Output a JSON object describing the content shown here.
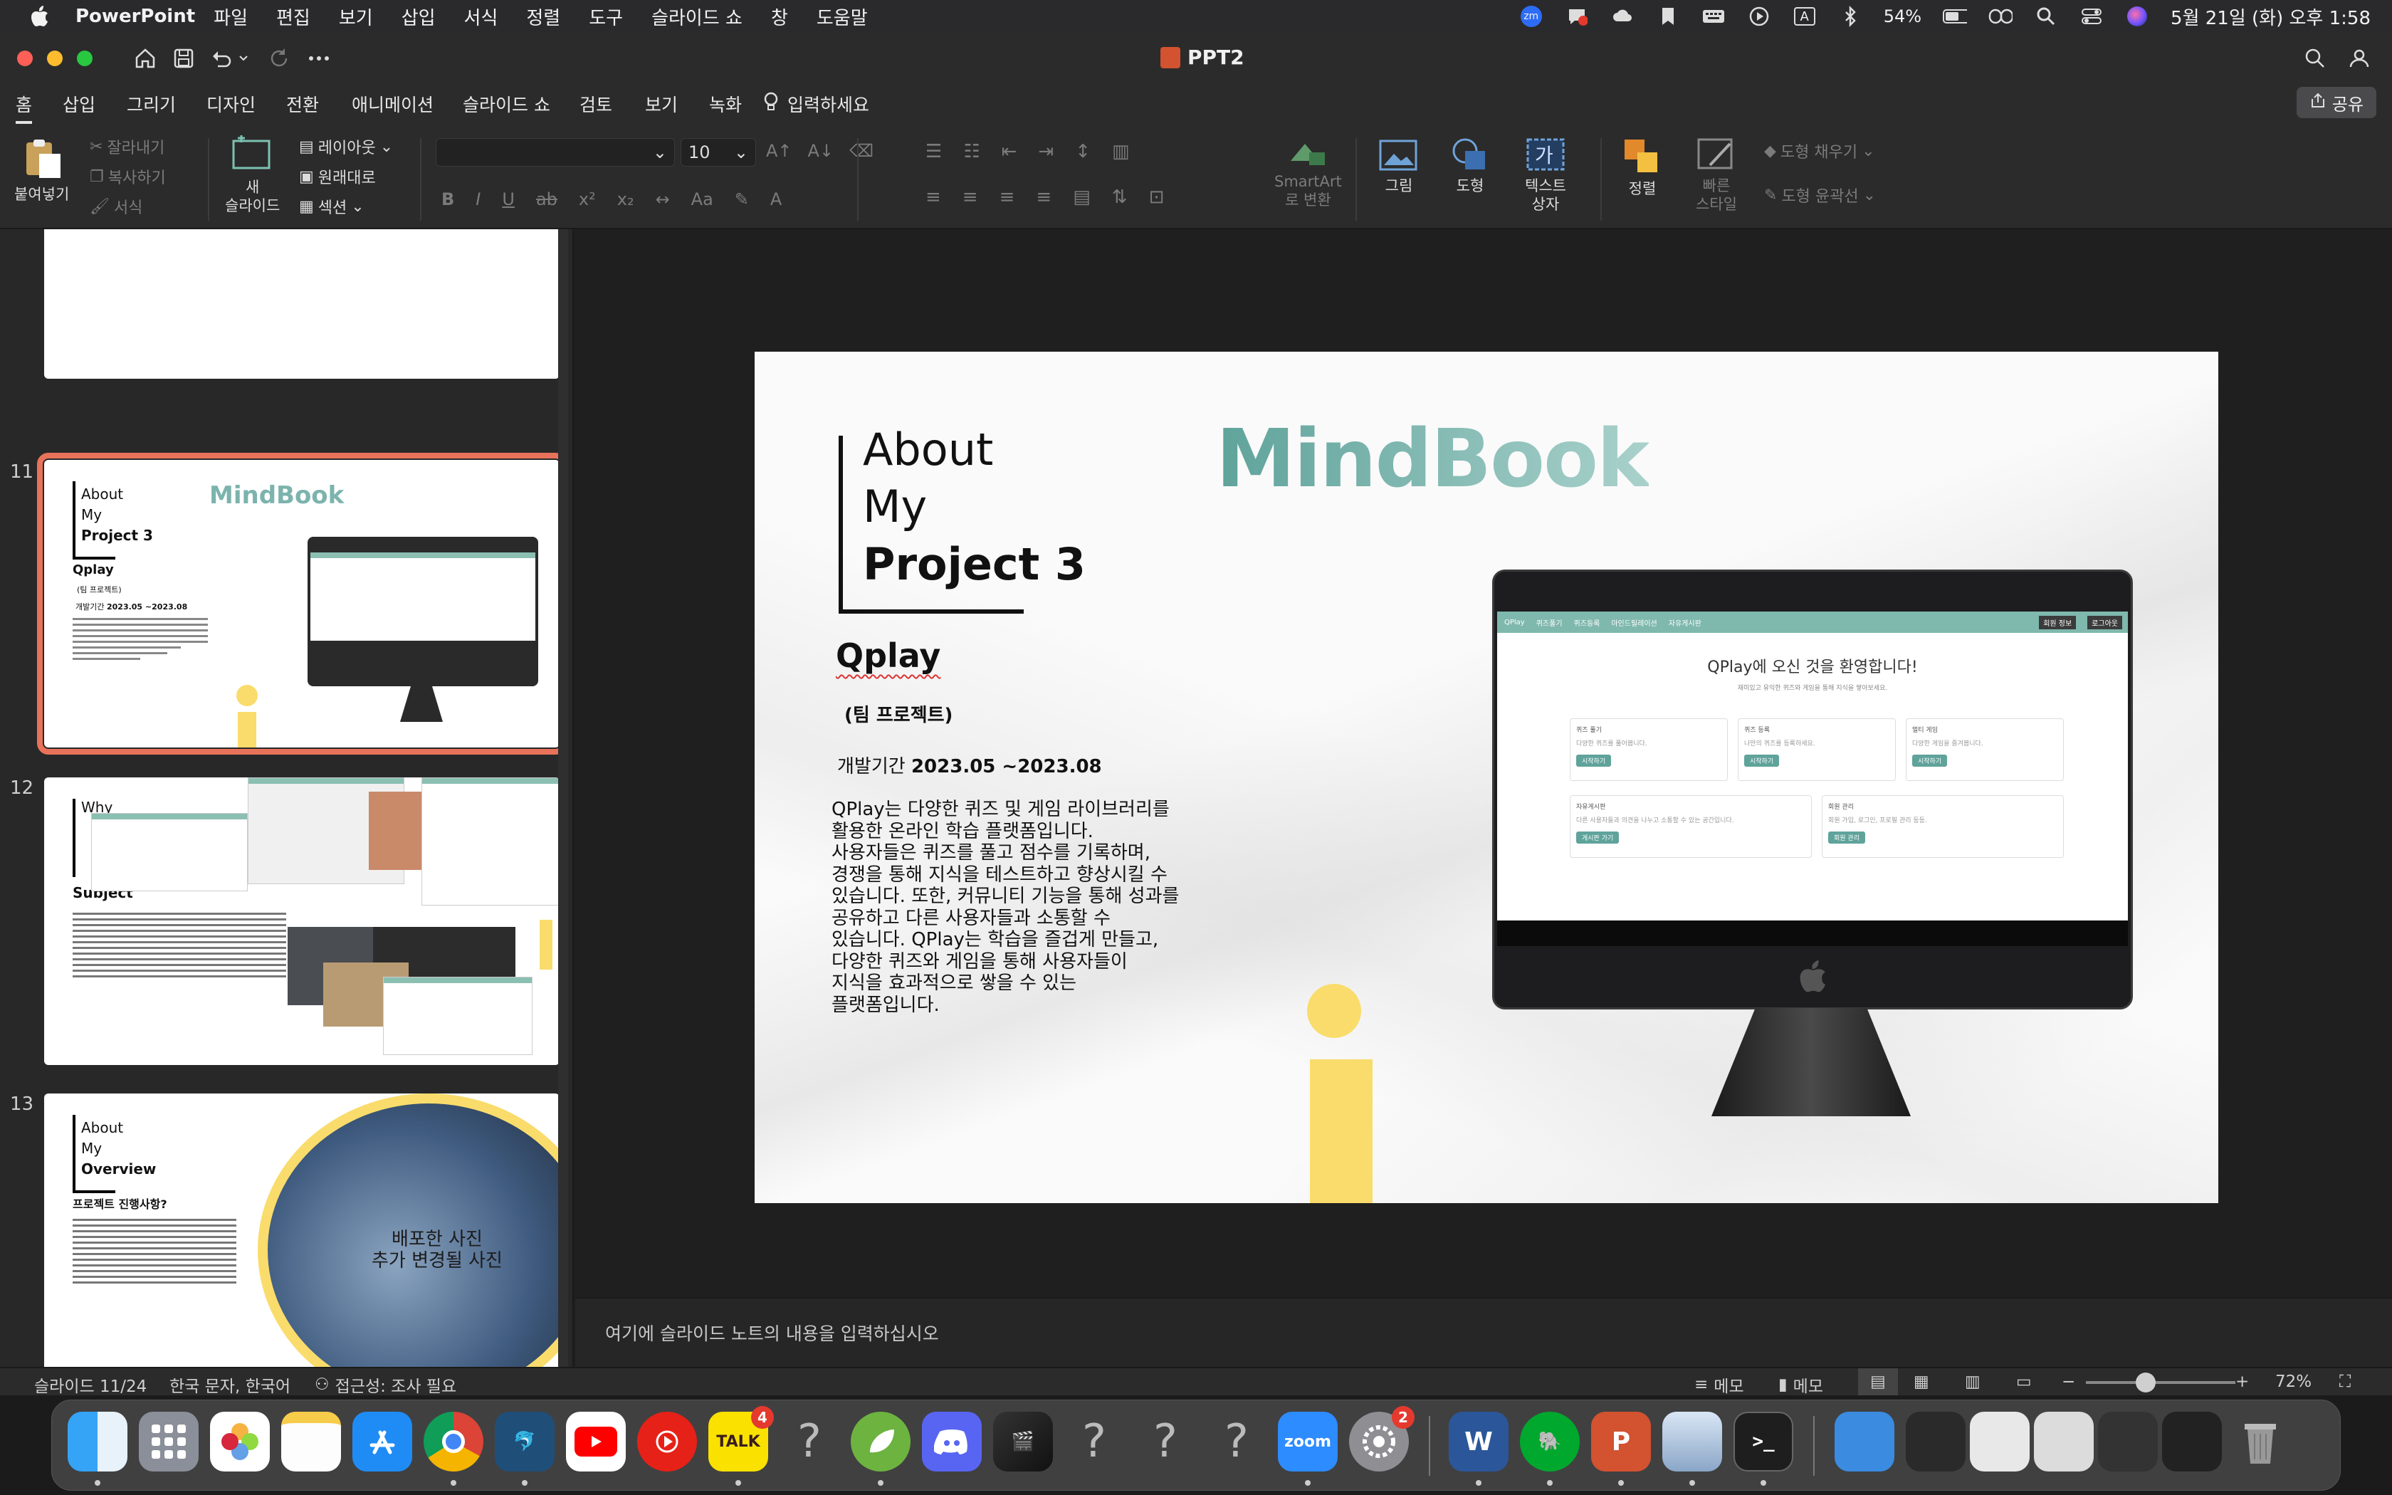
{
  "menubar": {
    "app_name": "PowerPoint",
    "items": [
      "파일",
      "편집",
      "보기",
      "삽입",
      "서식",
      "정렬",
      "도구",
      "슬라이드 쇼",
      "창",
      "도움말"
    ],
    "zoom_badge": "zm",
    "battery": "54%",
    "clock": "5월 21일 (화) 오후 1:58",
    "input_mode": "A"
  },
  "window": {
    "title": "PPT2"
  },
  "ribbon_tabs": {
    "tabs": [
      "홈",
      "삽입",
      "그리기",
      "디자인",
      "전환",
      "애니메이션",
      "슬라이드 쇼",
      "검토",
      "보기",
      "녹화"
    ],
    "tell_me": "입력하세요",
    "share": "공유"
  },
  "ribbon": {
    "paste": "붙여넣기",
    "cut": "잘라내기",
    "copy": "복사하기",
    "format": "서식",
    "new_slide": "새\n슬라이드",
    "layout": "레이아웃",
    "reset": "원래대로",
    "section": "섹션",
    "font_size": "10",
    "smartart": "SmartArt\n로 변환",
    "picture": "그림",
    "shape": "도형",
    "textbox": "텍스트\n상자",
    "arrange": "정렬",
    "quick_styles": "빠른\n스타일",
    "shape_fill": "도형 채우기",
    "shape_outline": "도형 윤곽선"
  },
  "thumbnails": [
    {
      "number": "11",
      "about": "About",
      "my": "My",
      "project": "Project 3",
      "brand": "MindBook",
      "name": "Qplay",
      "team": "(팀 프로젝트)",
      "period_label": "개발기간",
      "period": "2023.05 ~2023.08"
    },
    {
      "number": "12",
      "why": "Why",
      "subject": "Subject"
    },
    {
      "number": "13",
      "about": "About",
      "my": "My",
      "overview": "Overview",
      "question": "프로젝트 진행사항?",
      "photo_caption_1": "배포한 사진",
      "photo_caption_2": "추가 변경될 사진"
    }
  ],
  "slide": {
    "heading_line1": "About",
    "heading_line2": "My",
    "heading_line3": "Project 3",
    "brand": "MindBook",
    "project_name": "Qplay",
    "team": "(팀 프로젝트)",
    "period_label": "개발기간",
    "period": "2023.05 ~2023.08",
    "description": [
      "QPlay는 다양한 퀴즈 및 게임 라이브러리를",
      "활용한 온라인 학습 플랫폼입니다.",
      "사용자들은 퀴즈를 풀고 점수를 기록하며,",
      "경쟁을 통해 지식을 테스트하고 향상시킬 수",
      "있습니다. 또한, 커뮤니티 기능을 통해 성과를",
      "공유하고 다른 사용자들과 소통할 수",
      "있습니다. QPlay는 학습을 즐겁게 만들고,",
      "다양한 퀴즈와 게임을 통해 사용자들이",
      "지식을 효과적으로 쌓을 수 있는",
      "플랫폼입니다."
    ],
    "screen_welcome": "QPlay에 오신 것을 환영합니다!",
    "screen_nav": [
      "QPlay",
      "퀴즈풀기",
      "퀴즈등록",
      "마인드릴레이션",
      "자유게시판"
    ],
    "screen_nav_right": [
      "회원 정보",
      "로그아웃"
    ],
    "screen_subtitle": "재미있고 유익한 퀴즈와 게임을 통해 지식을 쌓아보세요.",
    "screen_cards": [
      {
        "title": "퀴즈 풀기",
        "text": "다양한 퀴즈를 풀어봅니다.",
        "btn": "시작하기"
      },
      {
        "title": "퀴즈 등록",
        "text": "나만의 퀴즈를 등록하세요.",
        "btn": "시작하기"
      },
      {
        "title": "멀티 게임",
        "text": "다양한 게임을 즐겨봅니다.",
        "btn": "시작하기"
      },
      {
        "title": "자유게시판",
        "text": "다른 사용자들과 의견을 나누고 소통할 수 있는 공간입니다.",
        "btn": "게시판 가기"
      },
      {
        "title": "회원 관리",
        "text": "회원 가입, 로그인, 프로필 관리 등등.",
        "btn": "회원 관리"
      }
    ]
  },
  "notes": {
    "placeholder": "여기에 슬라이드 노트의 내용을 입력하십시오"
  },
  "statusbar": {
    "slide_indicator": "슬라이드 11/24",
    "language": "한국 문자, 한국어",
    "accessibility": "접근성: 조사 필요",
    "notes": "메모",
    "comments": "메모",
    "zoom": "72%"
  },
  "dock": {
    "kakao_badge": "4",
    "settings_badge": "2",
    "kakao_label": "TALK",
    "zoom_label": "zoom",
    "word_label": "W",
    "ppt_label": "P",
    "question": "?"
  },
  "colors": {
    "accent_teal": "#5fa39b",
    "yellow_i": "#f9dc6b",
    "selection": "#e8735a"
  }
}
